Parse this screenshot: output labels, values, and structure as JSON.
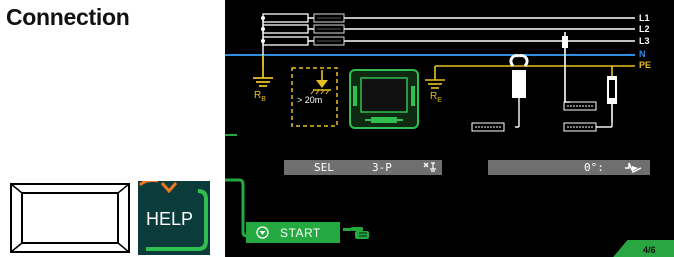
{
  "page": {
    "title": "Connection"
  },
  "help": {
    "label": "HELP"
  },
  "screen": {
    "line_labels": [
      "L1",
      "L2",
      "L3",
      "N",
      "PE"
    ],
    "rb_label": "R",
    "rb_sub": "B",
    "re_label": "R",
    "re_sub": "E",
    "distance_label": "> 20m",
    "status_left": {
      "sel": "SEL",
      "mode": "3-P"
    },
    "status_right": {
      "angle": "0°:"
    },
    "start_label": "START",
    "page_indicator": "4/6"
  },
  "colors": {
    "screen_bg": "#000000",
    "accent_green": "#24a840",
    "neutral_blue": "#2f8fe0",
    "pe_yellow": "#e8c020",
    "status_bar_gray": "#6f6f6f",
    "help_bg": "#0b3b3b",
    "help_accent": "#f07820"
  },
  "icons": [
    "clamp-meter-icon",
    "test-probe-icon",
    "earth-ground-icon",
    "tester-device-icon",
    "clamp-select-icon",
    "waveform-icon",
    "pointing-hand-icon",
    "chevron-down-icon"
  ]
}
